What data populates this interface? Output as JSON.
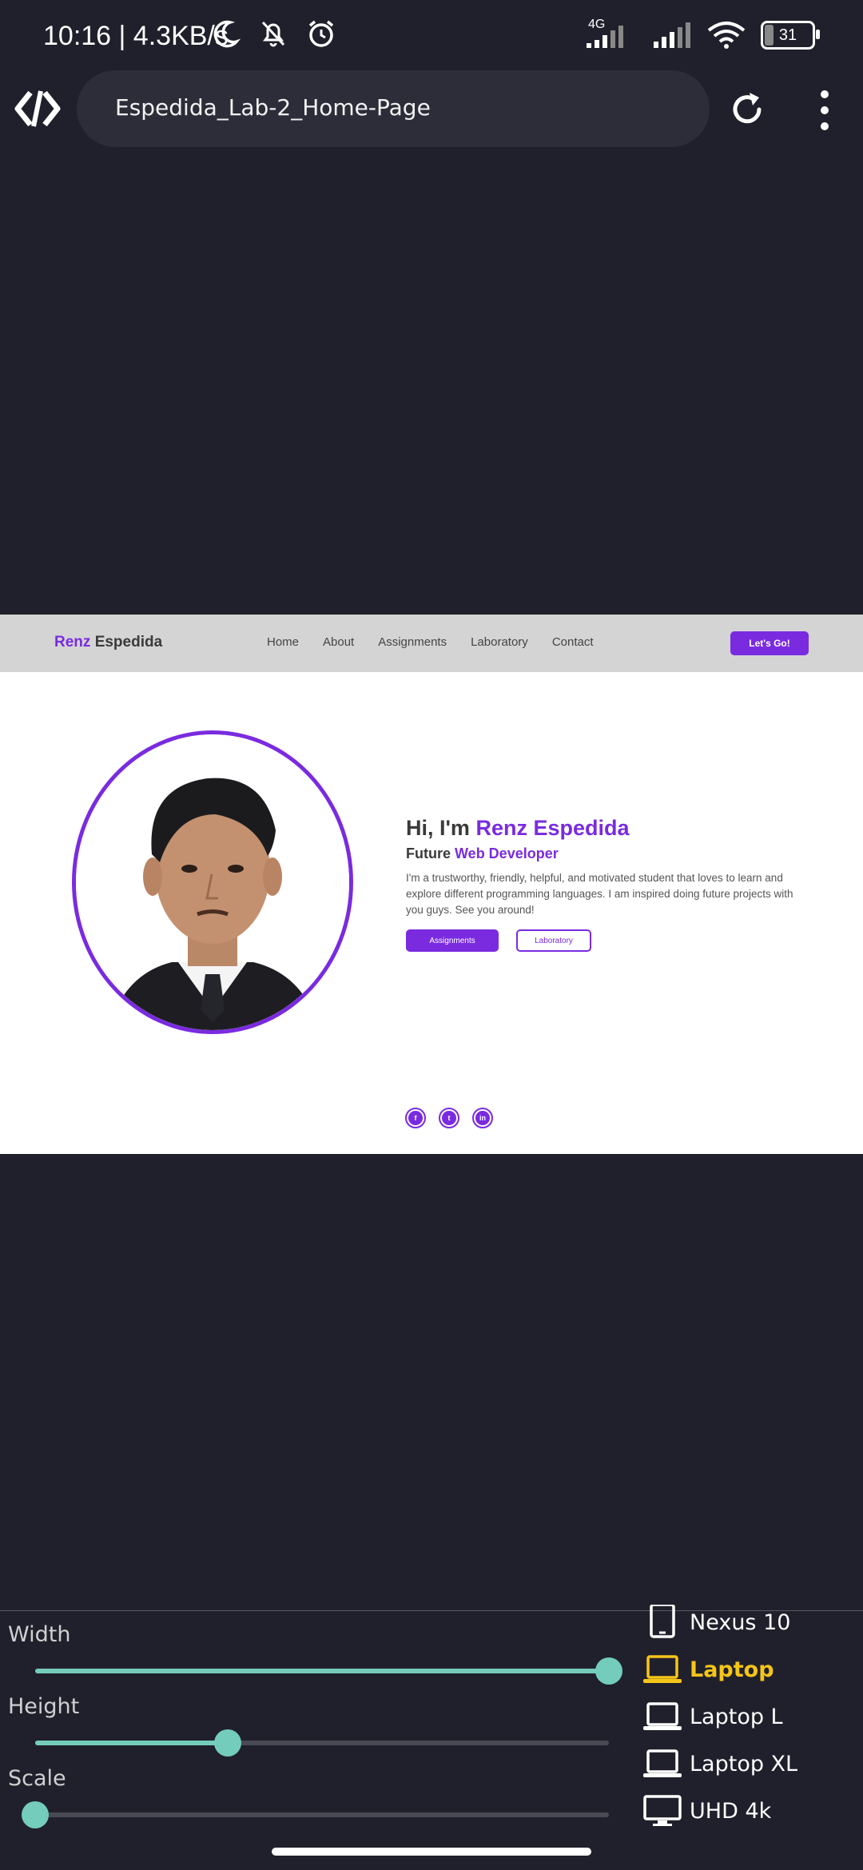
{
  "status_bar": {
    "time_speed": "10:16 | 4.3KB/s",
    "network": "4G",
    "battery": "31",
    "icons": [
      "moon-icon",
      "bell-off-icon",
      "alarm-icon",
      "signal-icon",
      "signal-icon",
      "wifi-icon",
      "battery-icon"
    ]
  },
  "browser": {
    "url_title": "Espedida_Lab-2_Home-Page",
    "icons": [
      "logo-icon",
      "reload-icon",
      "more-vert-icon"
    ]
  },
  "site": {
    "brand_first": "Renz",
    "brand_last": "Espedida",
    "nav": [
      "Home",
      "About",
      "Assignments",
      "Laboratory",
      "Contact"
    ],
    "cta": "Let's Go!",
    "hero": {
      "greeting": "Hi, I'm",
      "name": "Renz Espedida",
      "role_prefix": "Future",
      "role": "Web Developer",
      "bio": "I'm a trustworthy, friendly, helpful, and motivated student that loves to learn and explore different programming languages. I am inspired doing future projects with you guys. See you around!",
      "btn_primary": "Assignments",
      "btn_secondary": "Laboratory"
    },
    "socials": [
      {
        "icon": "facebook-icon",
        "glyph": "f"
      },
      {
        "icon": "twitter-icon",
        "glyph": "t"
      },
      {
        "icon": "linkedin-icon",
        "glyph": "in"
      }
    ],
    "accent_color": "#7a2be0"
  },
  "controls": {
    "width_label": "Width",
    "height_label": "Height",
    "scale_label": "Scale",
    "width_value": 1.0,
    "height_value": 0.335,
    "scale_value": 0.0,
    "devices": [
      {
        "label": "Nexus 10",
        "icon": "tablet-icon",
        "active": false
      },
      {
        "label": "Laptop",
        "icon": "laptop-icon",
        "active": true
      },
      {
        "label": "Laptop L",
        "icon": "laptop-icon",
        "active": false
      },
      {
        "label": "Laptop XL",
        "icon": "laptop-icon",
        "active": false
      },
      {
        "label": "UHD 4k",
        "icon": "monitor-icon",
        "active": false
      }
    ],
    "slider_color": "#74ccbc",
    "active_color": "#f5c518"
  }
}
